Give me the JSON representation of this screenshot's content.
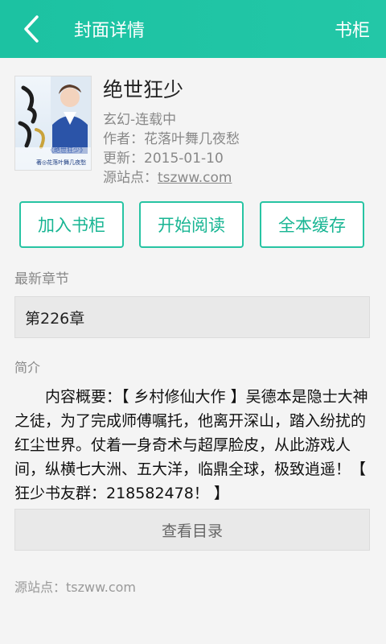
{
  "header": {
    "title": "封面详情",
    "shelf_label": "书柜",
    "back_icon": "chevron-left-icon",
    "accent_color": "#23c7a7"
  },
  "book": {
    "title": "绝世狂少",
    "genre_status": "玄幻-连载中",
    "author_label": "作者：",
    "author": "花落叶舞几夜愁",
    "updated_label": "更新：",
    "updated": "2015-01-10",
    "source_label": "源站点：",
    "source": "tszww.com",
    "cover_text": {
      "title": "绝世狂少",
      "subtitle": "《绝世狂少》",
      "author_line": "著◎花落叶舞几夜愁"
    }
  },
  "actions": {
    "add_shelf": "加入书柜",
    "start_read": "开始阅读",
    "cache_all": "全本缓存"
  },
  "latest": {
    "label": "最新章节",
    "chapter": "第226章"
  },
  "intro": {
    "label": "简介",
    "text": "内容概要：【 乡村修仙大作 】吴德本是隐士大神之徒，为了完成师傅嘱托，他离开深山，踏入纷扰的红尘世界。仗着一身奇术与超厚脸皮，从此游戏人间，纵横七大洲、五大洋，临鼎全球，极致逍遥！【 狂少书友群：218582478！ 】"
  },
  "toc_button": "查看目录",
  "footer": {
    "source_label": "源站点：",
    "source": "tszww.com"
  }
}
